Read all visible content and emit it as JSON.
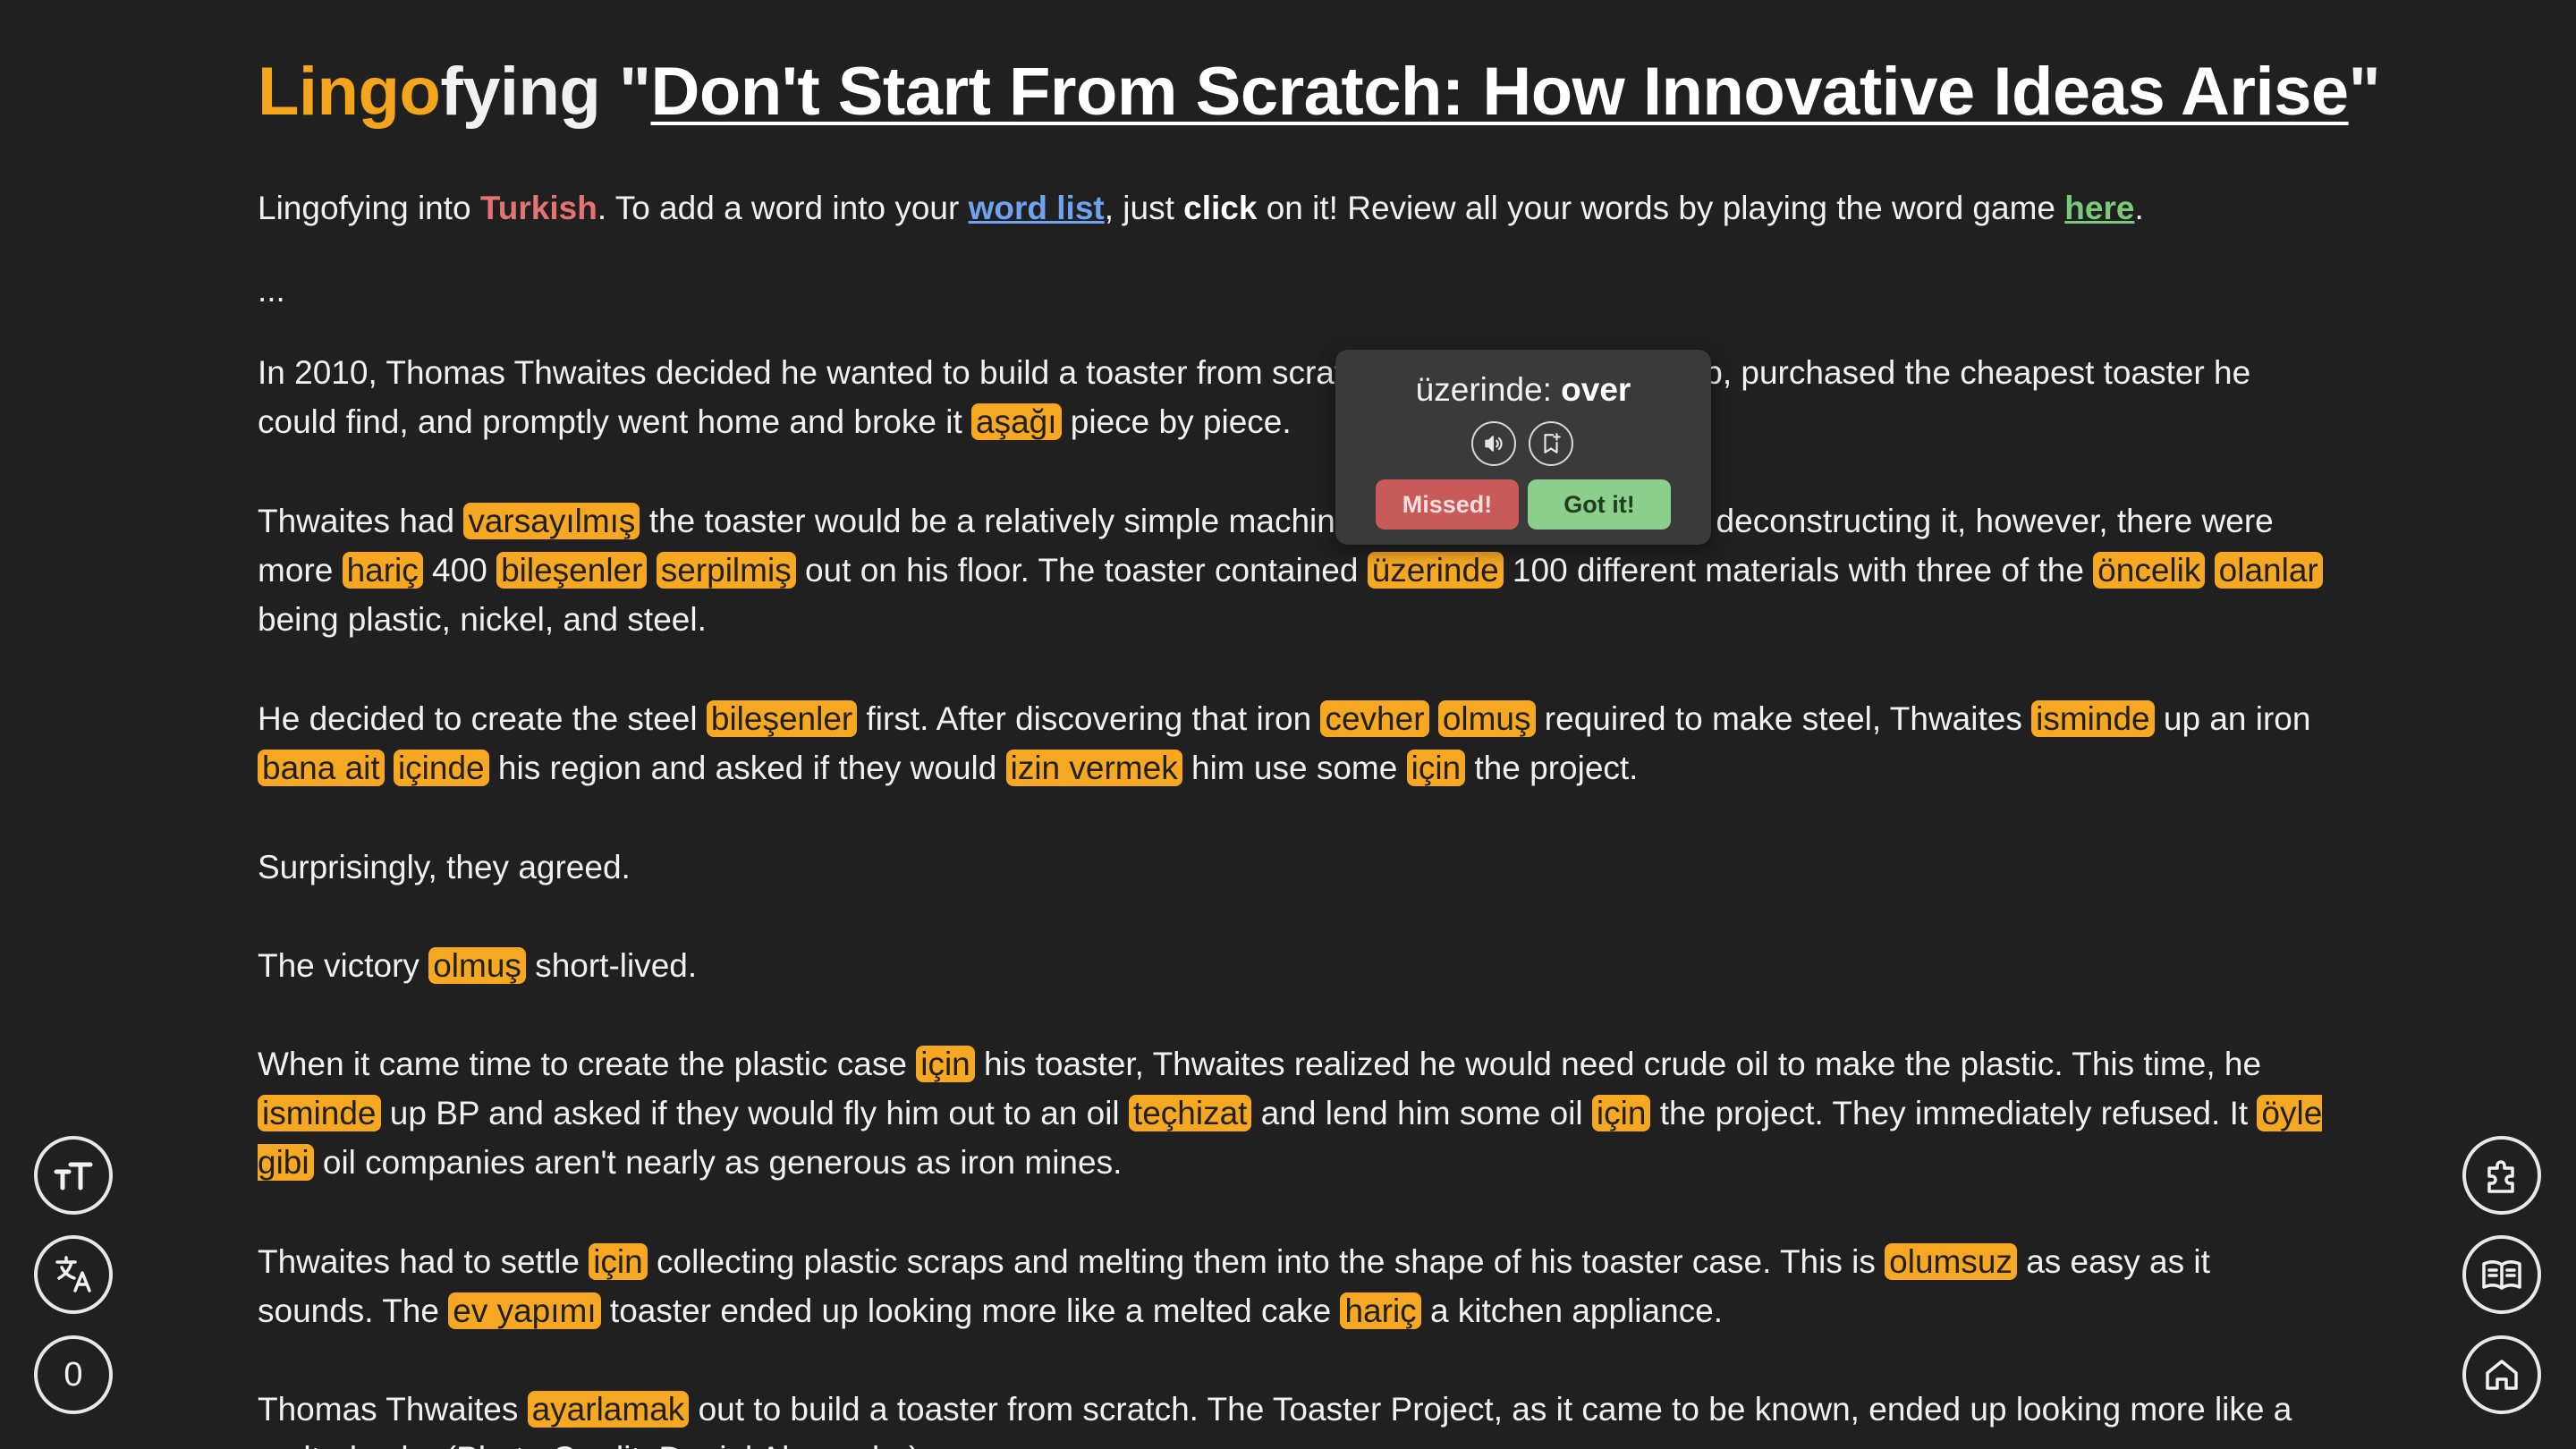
{
  "title": {
    "brand_part1": "Lingo",
    "brand_part2": "fying",
    "quote_open": " \"",
    "article": "Don't Start From Scratch: How Innovative Ideas Arise",
    "quote_close": "\""
  },
  "intro": {
    "t1": "Lingofying into ",
    "language": "Turkish",
    "t2": ". To add a word into your ",
    "word_list_link": "word list",
    "t3": ", just ",
    "click_bold": "click",
    "t4": " on it! Review all your words by playing the word game ",
    "here_link": "here",
    "t5": "."
  },
  "ellipsis": "...",
  "paragraphs": [
    {
      "id": "p1",
      "segments": [
        {
          "t": "In 2010, Thomas Thwaites decided he wanted to build a toaster from scratch. He walked into a shop, purchased the cheapest toaster he could find, and promptly went home and broke it "
        },
        {
          "w": "aşağı"
        },
        {
          "t": " piece by piece."
        }
      ]
    },
    {
      "id": "p2",
      "segments": [
        {
          "t": "Thwaites had "
        },
        {
          "w": "varsayılmış"
        },
        {
          "t": " the toaster would be a relatively simple machine. By the time he finished deconstructing it, however, there were more "
        },
        {
          "w": "hariç"
        },
        {
          "t": " 400 "
        },
        {
          "w": "bileşenler"
        },
        {
          "t": " "
        },
        {
          "w": "serpilmiş"
        },
        {
          "t": " out on his floor. The toaster contained "
        },
        {
          "w": "üzerinde"
        },
        {
          "t": " 100 different materials with three of the "
        },
        {
          "w": "öncelik"
        },
        {
          "t": " "
        },
        {
          "w": "olanlar"
        },
        {
          "t": " being plastic, nickel, and steel."
        }
      ]
    },
    {
      "id": "p3",
      "segments": [
        {
          "t": "He decided to create the steel "
        },
        {
          "w": "bileşenler"
        },
        {
          "t": " first. After discovering that iron "
        },
        {
          "w": "cevher"
        },
        {
          "t": " "
        },
        {
          "w": "olmuş"
        },
        {
          "t": " required to make steel, Thwaites "
        },
        {
          "w": "isminde"
        },
        {
          "t": " up an iron "
        },
        {
          "w": "bana ait"
        },
        {
          "t": " "
        },
        {
          "w": "içinde"
        },
        {
          "t": " his region and asked if they would "
        },
        {
          "w": "izin vermek"
        },
        {
          "t": " him use some "
        },
        {
          "w": "için"
        },
        {
          "t": " the project."
        }
      ]
    },
    {
      "id": "p4",
      "segments": [
        {
          "t": "Surprisingly, they agreed."
        }
      ]
    },
    {
      "id": "p5",
      "segments": [
        {
          "t": "The victory "
        },
        {
          "w": "olmuş"
        },
        {
          "t": " short-lived."
        }
      ]
    },
    {
      "id": "p6",
      "segments": [
        {
          "t": "When it came time to create the plastic case "
        },
        {
          "w": "için"
        },
        {
          "t": " his toaster, Thwaites realized he would need crude oil to make the plastic. This time, he "
        },
        {
          "w": "isminde"
        },
        {
          "t": " up BP and asked if they would fly him out to an oil "
        },
        {
          "w": "teçhizat"
        },
        {
          "t": " and lend him some oil "
        },
        {
          "w": "için"
        },
        {
          "t": " the project. They immediately refused. It "
        },
        {
          "w": "öyle gibi"
        },
        {
          "t": " oil companies aren't nearly as generous as iron mines."
        }
      ]
    },
    {
      "id": "p7",
      "segments": [
        {
          "t": "Thwaites had to settle "
        },
        {
          "w": "için"
        },
        {
          "t": " collecting plastic scraps and melting them into the shape of his toaster case. This is "
        },
        {
          "w": "olumsuz"
        },
        {
          "t": " as easy as it sounds. The "
        },
        {
          "w": "ev yapımı"
        },
        {
          "t": " toaster ended up looking more like a melted cake "
        },
        {
          "w": "hariç"
        },
        {
          "t": " a kitchen appliance."
        }
      ]
    },
    {
      "id": "p8",
      "segments": [
        {
          "t": "Thomas Thwaites "
        },
        {
          "w": "ayarlamak"
        },
        {
          "t": " out to build a toaster from scratch. The Toaster Project, as it came to be known, ended up looking more like a melted cake (Photo Credit: Daniel Alexander)."
        }
      ]
    }
  ],
  "popup": {
    "word": "üzerinde",
    "separator": ": ",
    "translation": "over",
    "speaker_icon": "speaker-icon",
    "bookmark_icon": "bookmark-add-icon",
    "missed_label": "Missed!",
    "gotit_label": "Got it!"
  },
  "left_controls": {
    "font_size_icon": "font-size-icon",
    "translate_icon": "translate-icon",
    "counter": "0"
  },
  "right_controls": {
    "puzzle_icon": "puzzle-icon",
    "reader_icon": "book-reader-icon",
    "home_icon": "home-icon"
  },
  "colors": {
    "background": "#202020",
    "highlight": "#f7a823",
    "brand": "#f4a51c",
    "language": "#e57373",
    "link_blue": "#6fa3f0",
    "link_green": "#7cc97c",
    "missed": "#c85a5a",
    "gotit": "#8ccf8c"
  }
}
